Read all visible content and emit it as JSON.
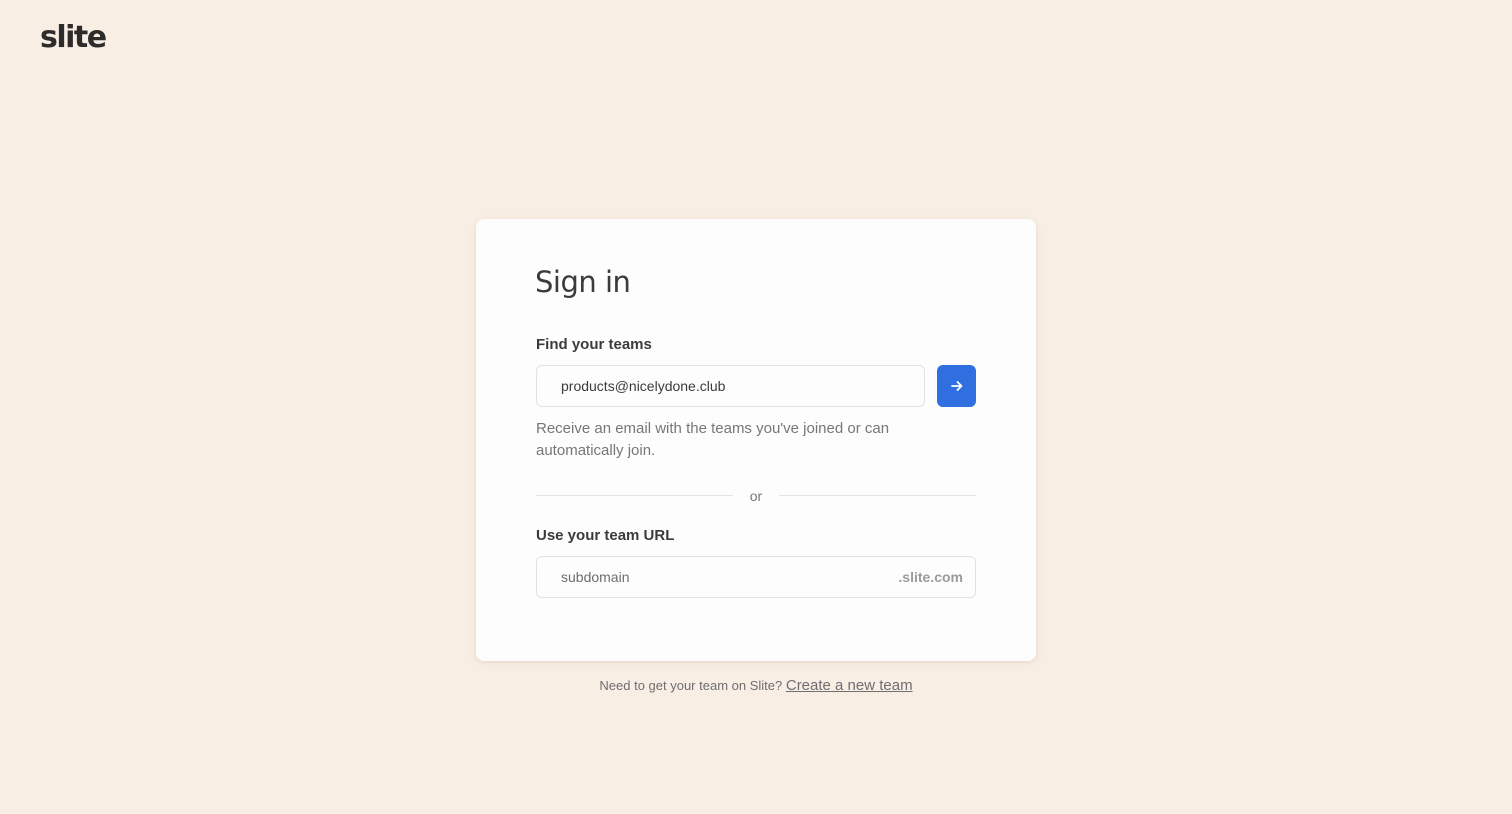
{
  "brand": {
    "logo_text": "slite"
  },
  "signin": {
    "title": "Sign in",
    "find_teams": {
      "label": "Find your teams",
      "email_value": "products@nicelydone.club",
      "submit_icon": "arrow-right-icon",
      "helper_text": "Receive an email with the teams you've joined or can automatically join."
    },
    "divider_text": "or",
    "team_url": {
      "label": "Use your team URL",
      "placeholder": "subdomain",
      "suffix": ".slite.com"
    }
  },
  "footer": {
    "prompt": "Need to get your team on Slite?",
    "link_text": "Create a new team"
  },
  "colors": {
    "background": "#f8eee4",
    "card": "#fdfdfd",
    "accent": "#2f6fe0"
  }
}
